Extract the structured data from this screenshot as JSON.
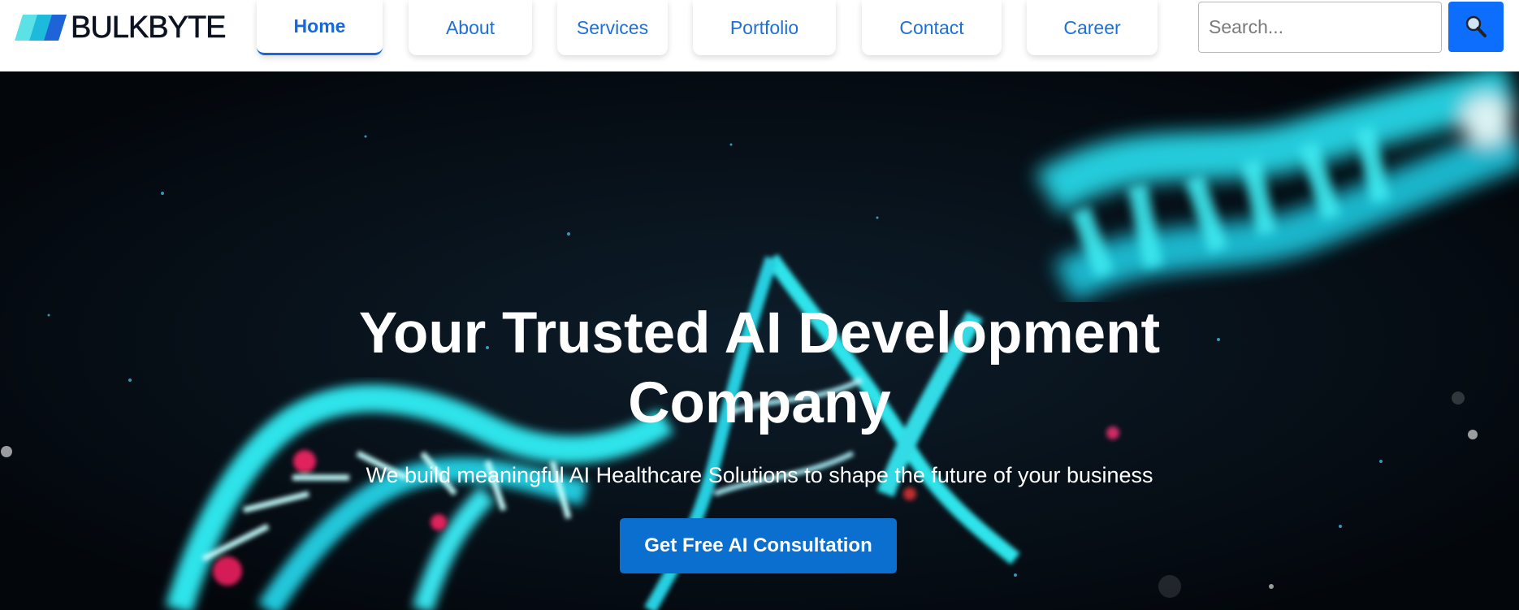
{
  "brand": {
    "name": "BULKBYTE"
  },
  "nav": {
    "items": [
      {
        "label": "Home",
        "active": true
      },
      {
        "label": "About",
        "active": false
      },
      {
        "label": "Services",
        "active": false
      },
      {
        "label": "Portfolio",
        "active": false
      },
      {
        "label": "Contact",
        "active": false
      },
      {
        "label": "Career",
        "active": false
      }
    ]
  },
  "search": {
    "placeholder": "Search...",
    "value": "",
    "button_icon": "search-icon"
  },
  "hero": {
    "title": "Your Trusted AI Development Company",
    "subtitle": "We build meaningful AI Healthcare Solutions to shape the future of your business",
    "cta_label": "Get Free AI Consultation",
    "background": "dna-helix-image"
  },
  "colors": {
    "accent": "#1668dc",
    "cta": "#0b6fd0",
    "search_button": "#0d6efd",
    "hero_bg": "#050b12",
    "helix": "#2fe3ea"
  }
}
